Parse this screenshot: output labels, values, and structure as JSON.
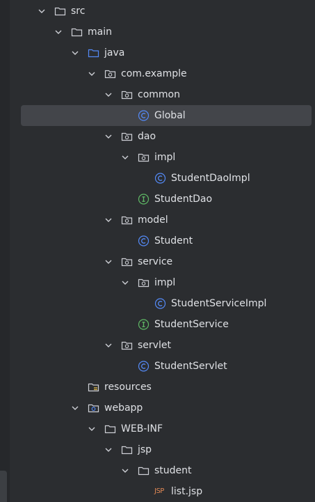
{
  "tree": {
    "items": [
      {
        "label": "src",
        "icon": "folder-icon",
        "expanded": true
      },
      {
        "label": "main",
        "icon": "folder-icon",
        "expanded": true
      },
      {
        "label": "java",
        "icon": "source-folder-icon",
        "expanded": true
      },
      {
        "label": "com.example",
        "icon": "package-icon",
        "expanded": true
      },
      {
        "label": "common",
        "icon": "package-icon",
        "expanded": true
      },
      {
        "label": "Global",
        "icon": "class-icon",
        "selected": true
      },
      {
        "label": "dao",
        "icon": "package-icon",
        "expanded": true
      },
      {
        "label": "impl",
        "icon": "package-icon",
        "expanded": true
      },
      {
        "label": "StudentDaoImpl",
        "icon": "class-icon"
      },
      {
        "label": "StudentDao",
        "icon": "interface-icon"
      },
      {
        "label": "model",
        "icon": "package-icon",
        "expanded": true
      },
      {
        "label": "Student",
        "icon": "class-icon"
      },
      {
        "label": "service",
        "icon": "package-icon",
        "expanded": true
      },
      {
        "label": "impl",
        "icon": "package-icon",
        "expanded": true
      },
      {
        "label": "StudentServiceImpl",
        "icon": "class-icon"
      },
      {
        "label": "StudentService",
        "icon": "interface-icon"
      },
      {
        "label": "servlet",
        "icon": "package-icon",
        "expanded": true
      },
      {
        "label": "StudentServlet",
        "icon": "class-icon"
      },
      {
        "label": "resources",
        "icon": "resources-folder-icon"
      },
      {
        "label": "webapp",
        "icon": "web-folder-icon",
        "expanded": true
      },
      {
        "label": "WEB-INF",
        "icon": "folder-icon",
        "expanded": true
      },
      {
        "label": "jsp",
        "icon": "folder-icon",
        "expanded": true
      },
      {
        "label": "student",
        "icon": "folder-icon",
        "expanded": true
      },
      {
        "label": "list.jsp",
        "icon": "jsp-icon",
        "icon_text": "JSP"
      }
    ]
  },
  "colors": {
    "background": "#2b2d30",
    "selection": "#43454a",
    "text": "#dfe1e5",
    "folder": "#ced0d6",
    "source_folder": "#548af7",
    "class": "#548af7",
    "interface": "#5fb865",
    "jsp": "#e08855"
  }
}
